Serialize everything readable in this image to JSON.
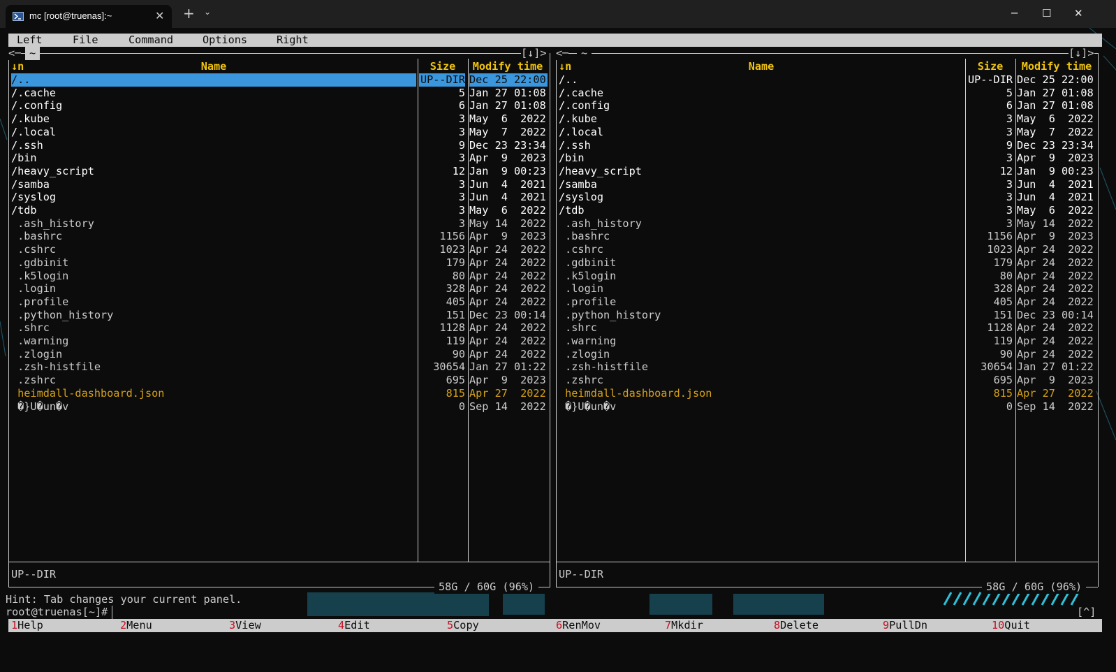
{
  "window": {
    "tab_title": "mc [root@truenas]:~",
    "new_tab_label": "+",
    "dropdown_label": "⌄",
    "close_tab": "✕",
    "minimize": "─",
    "maximize": "☐",
    "close": "✕"
  },
  "menubar": [
    "Left",
    "File",
    "Command",
    "Options",
    "Right"
  ],
  "panels": {
    "left": {
      "path": "~",
      "top_left_ctrl": "<─",
      "top_right_ctrl": "[↓]>",
      "status": "UP--DIR",
      "disk": "58G / 60G (96%)"
    },
    "right": {
      "path": "~",
      "top_left_ctrl": "<─",
      "top_right_ctrl": "[↓]>",
      "status": "UP--DIR",
      "disk": "58G / 60G (96%)"
    }
  },
  "columns": {
    "sort": "↓n",
    "name": "Name",
    "size": "Size",
    "mtime": "Modify time"
  },
  "files": [
    {
      "name": "/..",
      "size": "UP--DIR",
      "mtime": "Dec 25 22:00",
      "kind": "dir"
    },
    {
      "name": "/.cache",
      "size": "5",
      "mtime": "Jan 27 01:08",
      "kind": "dir"
    },
    {
      "name": "/.config",
      "size": "6",
      "mtime": "Jan 27 01:08",
      "kind": "dir"
    },
    {
      "name": "/.kube",
      "size": "3",
      "mtime": "May  6  2022",
      "kind": "dir"
    },
    {
      "name": "/.local",
      "size": "3",
      "mtime": "May  7  2022",
      "kind": "dir"
    },
    {
      "name": "/.ssh",
      "size": "9",
      "mtime": "Dec 23 23:34",
      "kind": "dir"
    },
    {
      "name": "/bin",
      "size": "3",
      "mtime": "Apr  9  2023",
      "kind": "dir"
    },
    {
      "name": "/heavy_script",
      "size": "12",
      "mtime": "Jan  9 00:23",
      "kind": "dir"
    },
    {
      "name": "/samba",
      "size": "3",
      "mtime": "Jun  4  2021",
      "kind": "dir"
    },
    {
      "name": "/syslog",
      "size": "3",
      "mtime": "Jun  4  2021",
      "kind": "dir"
    },
    {
      "name": "/tdb",
      "size": "3",
      "mtime": "May  6  2022",
      "kind": "dir"
    },
    {
      "name": " .ash_history",
      "size": "3",
      "mtime": "May 14  2022",
      "kind": "file"
    },
    {
      "name": " .bashrc",
      "size": "1156",
      "mtime": "Apr  9  2023",
      "kind": "file"
    },
    {
      "name": " .cshrc",
      "size": "1023",
      "mtime": "Apr 24  2022",
      "kind": "file"
    },
    {
      "name": " .gdbinit",
      "size": "179",
      "mtime": "Apr 24  2022",
      "kind": "file"
    },
    {
      "name": " .k5login",
      "size": "80",
      "mtime": "Apr 24  2022",
      "kind": "file"
    },
    {
      "name": " .login",
      "size": "328",
      "mtime": "Apr 24  2022",
      "kind": "file"
    },
    {
      "name": " .profile",
      "size": "405",
      "mtime": "Apr 24  2022",
      "kind": "file"
    },
    {
      "name": " .python_history",
      "size": "151",
      "mtime": "Dec 23 00:14",
      "kind": "file"
    },
    {
      "name": " .shrc",
      "size": "1128",
      "mtime": "Apr 24  2022",
      "kind": "file"
    },
    {
      "name": " .warning",
      "size": "119",
      "mtime": "Apr 24  2022",
      "kind": "file"
    },
    {
      "name": " .zlogin",
      "size": "90",
      "mtime": "Apr 24  2022",
      "kind": "file"
    },
    {
      "name": " .zsh-histfile",
      "size": "30654",
      "mtime": "Jan 27 01:22",
      "kind": "file"
    },
    {
      "name": " .zshrc",
      "size": "695",
      "mtime": "Apr  9  2023",
      "kind": "file"
    },
    {
      "name": " heimdall-dashboard.json",
      "size": "815",
      "mtime": "Apr 27  2022",
      "kind": "hl"
    },
    {
      "name": " �}U�un�v",
      "size": "0",
      "mtime": "Sep 14  2022",
      "kind": "file"
    }
  ],
  "hint": "Hint: Tab changes your current panel.",
  "prompt": "root@truenas[~]#",
  "prompt_right": "[^]",
  "fkeys": [
    {
      "num": "1",
      "label": "Help"
    },
    {
      "num": "2",
      "label": "Menu"
    },
    {
      "num": "3",
      "label": "View"
    },
    {
      "num": "4",
      "label": "Edit"
    },
    {
      "num": "5",
      "label": "Copy"
    },
    {
      "num": "6",
      "label": "RenMov"
    },
    {
      "num": "7",
      "label": "Mkdir"
    },
    {
      "num": "8",
      "label": "Delete"
    },
    {
      "num": "9",
      "label": "PullDn"
    },
    {
      "num": "10",
      "label": "Quit"
    }
  ],
  "colors": {
    "background": "#0c0c0c",
    "foreground": "#cccccc",
    "header": "#f1c40f",
    "selection": "#3a96dd",
    "highlight_file": "#d4a017",
    "fkey_number": "#c50f1f",
    "bar": "#cccccc"
  }
}
